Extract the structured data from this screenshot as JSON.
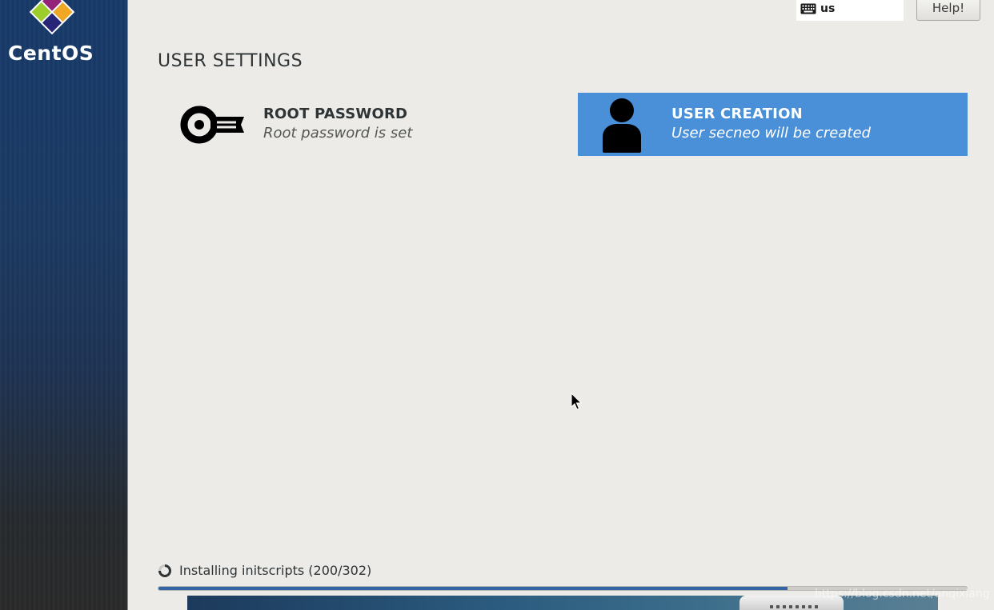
{
  "sidebar": {
    "logo_text": "CentOS",
    "logo_icon": "centos-logo-icon"
  },
  "header": {
    "keyboard_layout": "us",
    "keyboard_icon": "keyboard-icon",
    "help_label": "Help!"
  },
  "section": {
    "title": "USER SETTINGS"
  },
  "spokes": [
    {
      "title": "ROOT PASSWORD",
      "status": "Root password is set",
      "icon": "key-icon",
      "selected": false
    },
    {
      "title": "USER CREATION",
      "status": "User secneo will be created",
      "icon": "user-icon",
      "selected": true,
      "highlight_color": "#4a90d9"
    }
  ],
  "progress": {
    "status_text": "Installing initscripts (200/302)",
    "current": 200,
    "total": 302,
    "fill_fraction": 0.778,
    "bar_color": "#3465a4"
  },
  "watermark": "https://blog.csdn.net/anqixiang"
}
